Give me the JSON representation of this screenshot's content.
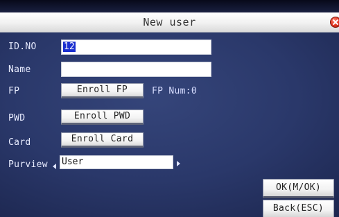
{
  "window": {
    "title": "New user"
  },
  "form": {
    "id_no": {
      "label": "ID.NO",
      "value": "12"
    },
    "name": {
      "label": "Name",
      "value": ""
    },
    "fp": {
      "label": "FP",
      "button": "Enroll FP",
      "info": "FP Num:0"
    },
    "pwd": {
      "label": "PWD",
      "button": "Enroll PWD"
    },
    "card": {
      "label": "Card",
      "button": "Enroll Card"
    },
    "purview": {
      "label": "Purview",
      "value": "User"
    }
  },
  "actions": {
    "ok": "OK(M/OK)",
    "back": "Back(ESC)"
  },
  "colors": {
    "background": "#2a386a",
    "title_bar": "#f1f1f1",
    "selection": "#1a2fd0",
    "close_icon": "#e0331f"
  },
  "icons": {
    "close": "close-icon",
    "purview_prev": "arrow-left-icon",
    "purview_next": "arrow-right-icon"
  }
}
